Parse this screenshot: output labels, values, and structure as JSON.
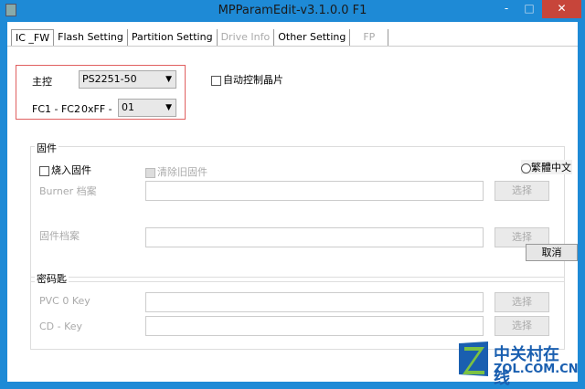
{
  "window": {
    "title": "MPParamEdit-v3.1.0.0 F1",
    "min": "-",
    "max": "□",
    "close": "✕"
  },
  "tabs": [
    {
      "label": "IC _FW"
    },
    {
      "label": "Flash Setting"
    },
    {
      "label": "Partition Setting"
    },
    {
      "label": "Drive Info"
    },
    {
      "label": "Other Setting"
    },
    {
      "label": "FP"
    }
  ],
  "controller": {
    "label": "主控",
    "value": "PS2251-50"
  },
  "fc": {
    "label": "FC1 - FC2",
    "prefix": "0xFF -",
    "value": "01"
  },
  "auto_chip": {
    "label": "自动控制晶片",
    "checked": false
  },
  "firmware": {
    "title": "固件",
    "burn_label": "烧入固件",
    "clear_label": "清除旧固件",
    "burner_label": "Burner 档案",
    "burner_value": "",
    "fw_label": "固件档案",
    "fw_value": "",
    "select": "选择"
  },
  "lang_radio": "繁體中文",
  "cancel": "取消",
  "keys": {
    "title": "密码匙",
    "pvc_label": "PVC 0 Key",
    "pvc_value": "",
    "cd_label": "CD - Key",
    "cd_value": "",
    "select": "选择"
  },
  "watermark": {
    "cn": "中关村在线",
    "en": "ZOL.COM.CN"
  }
}
